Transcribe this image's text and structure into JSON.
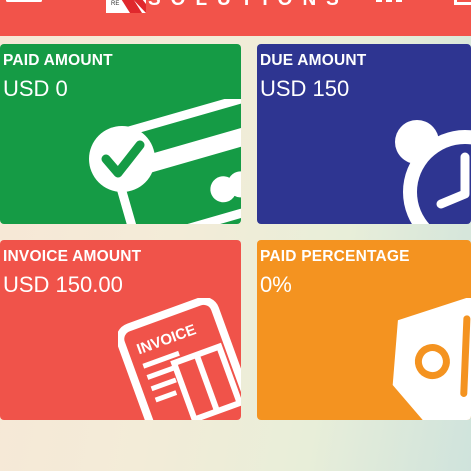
{
  "header": {
    "logo_text": "SOLUTIONS",
    "logo_badge": "RE",
    "bar_color": "#f2534a"
  },
  "cards": [
    {
      "id": "paid",
      "label": "PAID AMOUNT",
      "value": "USD 0",
      "color": "#159b45",
      "icon": "credit-card-check-icon"
    },
    {
      "id": "due",
      "label": "DUE AMOUNT",
      "value": "USD 150",
      "color": "#2e3591",
      "icon": "alarm-clock-icon"
    },
    {
      "id": "invoice",
      "label": "INVOICE AMOUNT",
      "value": "USD 150.00",
      "color": "#f0534a",
      "icon": "invoice-document-icon",
      "icon_text": "INVOICE"
    },
    {
      "id": "percent",
      "label": "PAID PERCENTAGE",
      "value": "0%",
      "color": "#f49320",
      "icon": "percent-tag-icon"
    }
  ]
}
